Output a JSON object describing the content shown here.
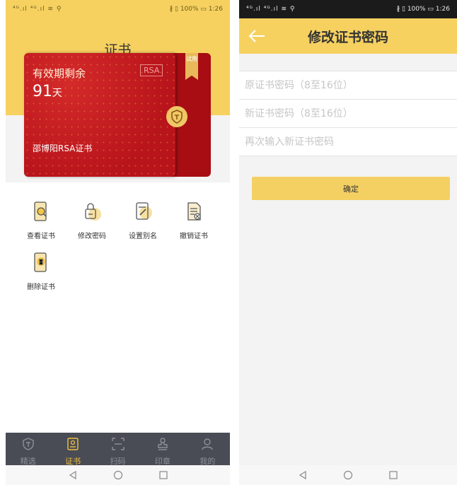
{
  "status": {
    "left_icons": "⁴ᴳ.ıl ⁴ᴳ.ıl ≋ ⚲",
    "right_text": "∦ ▯ 100% ▭ 1:26"
  },
  "certificate": {
    "title": "证书",
    "card": {
      "validity_label": "有效期剩余",
      "days": "91",
      "days_unit": "天",
      "algo_tag": "RSA",
      "cert_name": "邵博阳RSA证书",
      "ribbon_text": "试用"
    },
    "actions": [
      {
        "label": "查看证书",
        "icon": "view-cert-icon"
      },
      {
        "label": "修改密码",
        "icon": "change-password-icon"
      },
      {
        "label": "设置别名",
        "icon": "set-alias-icon"
      },
      {
        "label": "撤销证书",
        "icon": "revoke-cert-icon"
      },
      {
        "label": "删除证书",
        "icon": "delete-cert-icon"
      }
    ],
    "tabs": [
      {
        "label": "精选",
        "icon": "shield-icon",
        "active": false
      },
      {
        "label": "证书",
        "icon": "certificate-icon",
        "active": true
      },
      {
        "label": "扫码",
        "icon": "scan-icon",
        "active": false
      },
      {
        "label": "印章",
        "icon": "seal-icon",
        "active": false
      },
      {
        "label": "我的",
        "icon": "user-icon",
        "active": false
      }
    ]
  },
  "change_password": {
    "title": "修改证书密码",
    "fields": {
      "old_placeholder": "原证书密码（8至16位）",
      "new_placeholder": "新证书密码（8至16位）",
      "confirm_placeholder": "再次输入新证书密码"
    },
    "confirm_label": "确定"
  },
  "colors": {
    "accent": "#f6d160",
    "card_red": "#b8141b",
    "tabbar": "#4a4c55",
    "active_tab": "#f0c040"
  }
}
